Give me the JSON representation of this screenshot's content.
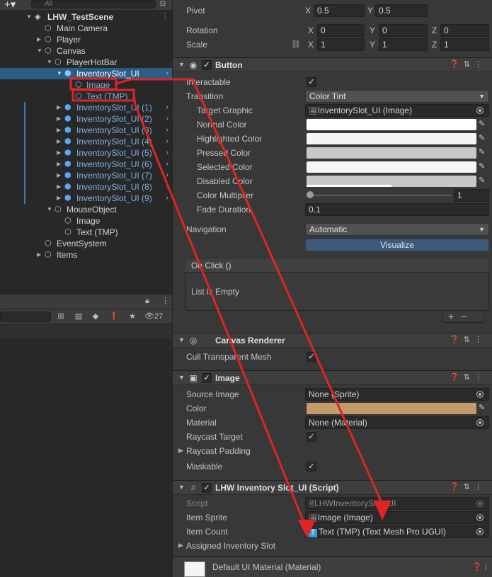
{
  "hierarchy": {
    "search_placeholder": "All",
    "badge_count": "27",
    "rows": [
      {
        "label": "LHW_TestScene"
      },
      {
        "label": "Main Camera"
      },
      {
        "label": "Player"
      },
      {
        "label": "Canvas"
      },
      {
        "label": "PlayerHotBar"
      },
      {
        "label": "InventorySlot_UI"
      },
      {
        "label": "Image"
      },
      {
        "label": "Text (TMP)"
      },
      {
        "label": "InventorySlot_UI (1)"
      },
      {
        "label": "InventorySlot_UI (2)"
      },
      {
        "label": "InventorySlot_UI (3)"
      },
      {
        "label": "InventorySlot_UI (4)"
      },
      {
        "label": "InventorySlot_UI (5)"
      },
      {
        "label": "InventorySlot_UI (6)"
      },
      {
        "label": "InventorySlot_UI (7)"
      },
      {
        "label": "InventorySlot_UI (8)"
      },
      {
        "label": "InventorySlot_UI (9)"
      },
      {
        "label": "MouseObject"
      },
      {
        "label": "Image"
      },
      {
        "label": "Text (TMP)"
      },
      {
        "label": "EventSystem"
      },
      {
        "label": "Items"
      }
    ]
  },
  "inspector": {
    "pivot": {
      "label": "Pivot",
      "x": "0.5",
      "y": "0.5"
    },
    "rotation": {
      "label": "Rotation",
      "x": "0",
      "y": "0",
      "z": "0"
    },
    "scale": {
      "label": "Scale",
      "x": "1",
      "y": "1",
      "z": "1"
    },
    "axis": {
      "x": "X",
      "y": "Y",
      "z": "Z"
    },
    "button": {
      "title": "Button",
      "interactable": "Interactable",
      "transition": "Transition",
      "transition_value": "Color Tint",
      "target_graphic": "Target Graphic",
      "target_graphic_value": "InventorySlot_UI (Image)",
      "normal_color": "Normal Color",
      "highlighted_color": "Highlighted Color",
      "pressed_color": "Pressed Color",
      "selected_color": "Selected Color",
      "disabled_color": "Disabled Color",
      "color_multiplier": "Color Multiplier",
      "color_multiplier_value": "1",
      "fade_duration": "Fade Duration",
      "fade_duration_value": "0.1",
      "navigation": "Navigation",
      "navigation_value": "Automatic",
      "visualize": "Visualize",
      "onclick": "On Click ()",
      "list_empty": "List is Empty",
      "colors": {
        "normal": "#ffffff",
        "highlighted": "#f5f5f5",
        "pressed": "#c8c8c8",
        "selected": "#f5f5f5",
        "disabled": "#c8c8c8"
      }
    },
    "canvas_renderer": {
      "title": "Canvas Renderer",
      "cull": "Cull Transparent Mesh"
    },
    "image": {
      "title": "Image",
      "source_image": "Source Image",
      "source_image_value": "None (Sprite)",
      "color": "Color",
      "color_value": "#c49a68",
      "material": "Material",
      "material_value": "None (Material)",
      "raycast_target": "Raycast Target",
      "raycast_padding": "Raycast Padding",
      "maskable": "Maskable"
    },
    "script": {
      "title": "LHW Inventory Slot_UI (Script)",
      "script_label": "Script",
      "script_value": "LHWInventorySlot_UI",
      "item_sprite": "Item Sprite",
      "item_sprite_value": "Image (Image)",
      "item_count": "Item Count",
      "item_count_value": "Text (TMP) (Text Mesh Pro UGUI)",
      "assigned": "Assigned Inventory Slot"
    },
    "material_footer": "Default UI Material (Material)"
  },
  "annotation_color": "#e02424"
}
